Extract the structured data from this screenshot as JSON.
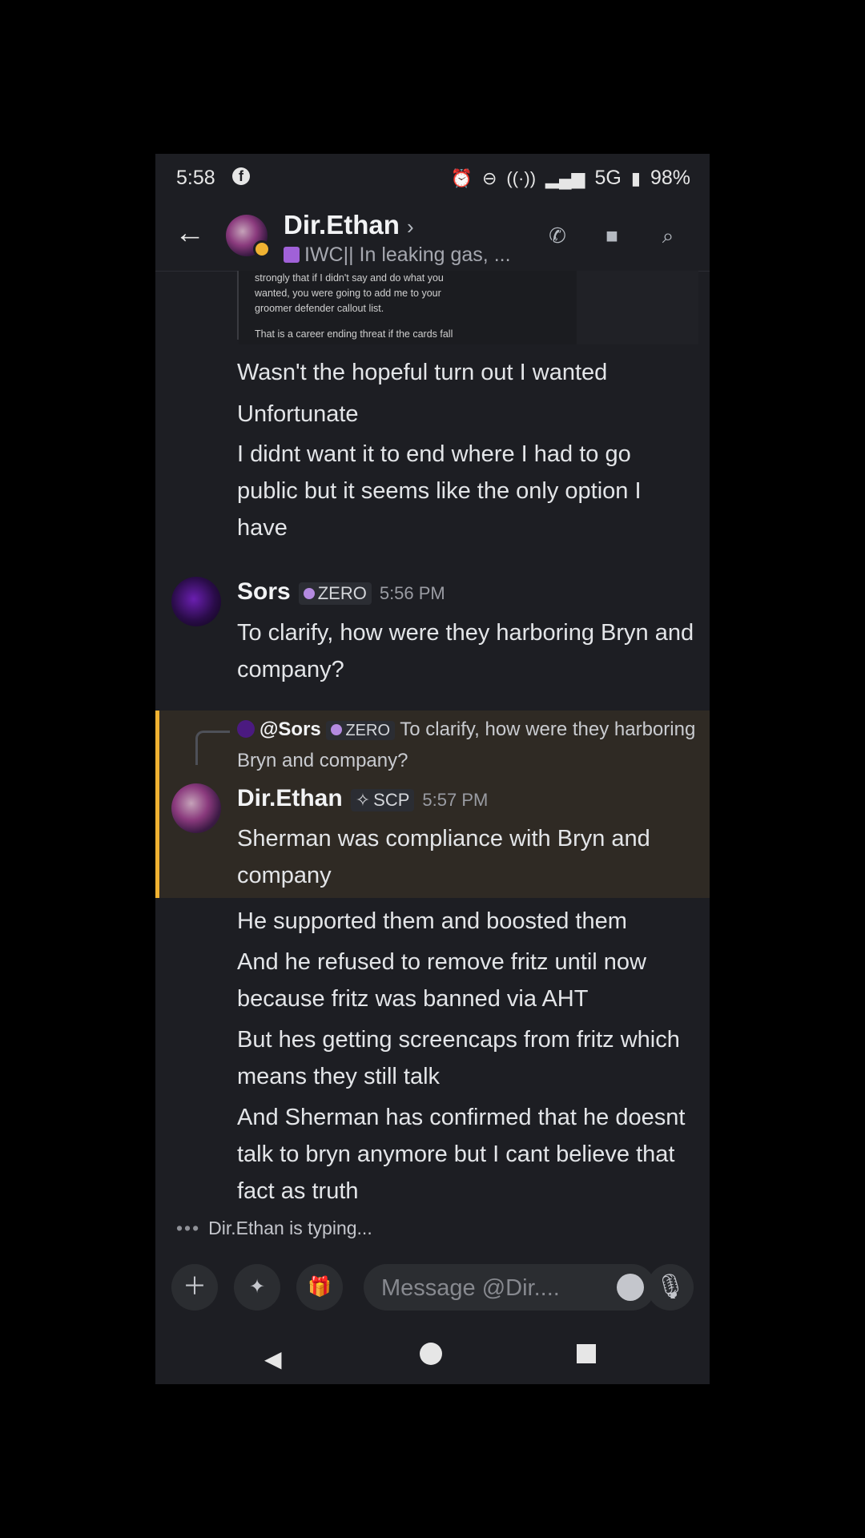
{
  "status_bar": {
    "time": "5:58",
    "app_icon": "f",
    "network": "5G",
    "battery": "98%"
  },
  "header": {
    "contact_name": "Dir.Ethan",
    "chevron": "›",
    "custom_status": "IWC|| In leaking gas, ..."
  },
  "embed": {
    "lines": [
      "strongly that if I didn't say and do what you",
      "wanted, you were going to add me to your",
      "groomer defender callout list.",
      "That is a career ending threat if the cards fall"
    ]
  },
  "messages": {
    "m1_lines": [
      "Wasn't the hopeful turn out I wanted",
      "Unfortunate",
      "I didnt want it to end where I had to go public but it seems like the only option I have"
    ],
    "sors": {
      "author": "Sors",
      "tag": "ZERO",
      "time": "5:56 PM",
      "text": "To clarify, how were they harboring Bryn and company?"
    },
    "reply": {
      "mention": "@Sors",
      "tag": "ZERO",
      "text": "To clarify, how were they harboring Bryn and company?"
    },
    "ethan": {
      "author": "Dir.Ethan",
      "tag": "SCP",
      "time": "5:57 PM",
      "lines": [
        "Sherman was compliance with Bryn and company",
        "He supported them and boosted them",
        "And he refused to remove fritz until now because fritz was banned via AHT",
        "But hes getting screencaps from fritz which means they still talk",
        "And Sherman has confirmed that he doesnt talk to bryn anymore but I cant believe that fact as truth"
      ]
    }
  },
  "typing": {
    "dots": "•••",
    "text": "Dir.Ethan is typing..."
  },
  "composer": {
    "placeholder": "Message @Dir...."
  },
  "colors": {
    "highlight_bar": "#f0b232",
    "highlight_bg": "#2f2a24",
    "background": "#1d1e23"
  }
}
